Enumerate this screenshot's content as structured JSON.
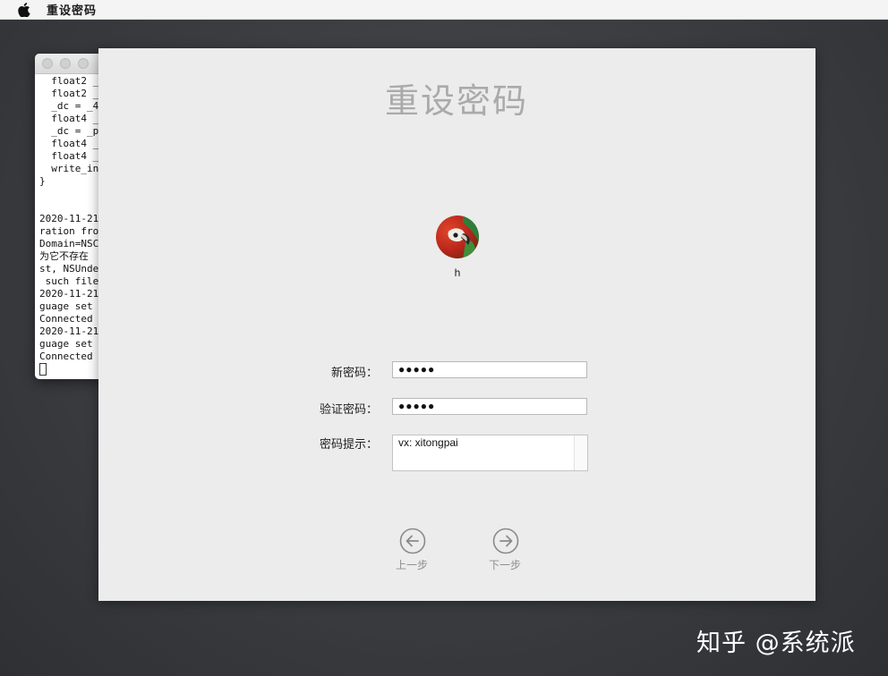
{
  "menubar": {
    "app_title": "重设密码"
  },
  "terminal": {
    "lines": [
      "  float2 _",
      "  float2 _",
      "  _dc = _4",
      "  float4 _",
      "  _dc = _p",
      "  float4 _",
      "  float4 _",
      "  write_in",
      "}",
      "",
      "",
      "2020-11-21",
      "ration fro",
      "Domain=NSC",
      "为它不存在",
      "st, NSUnde",
      " such file",
      "2020-11-21",
      "guage set",
      "Connected",
      "2020-11-21",
      "guage set",
      "Connected"
    ]
  },
  "panel": {
    "title": "重设密码",
    "user": {
      "name": "h"
    },
    "new_password": {
      "label": "新密码：",
      "value": "●●●●●"
    },
    "verify_password": {
      "label": "验证密码：",
      "value": "●●●●●"
    },
    "password_hint": {
      "label": "密码提示：",
      "value": "vx: xitongpai"
    },
    "back_button": {
      "label": "上一步",
      "icon": "arrow-left-circle-icon"
    },
    "next_button": {
      "label": "下一步",
      "icon": "arrow-right-circle-icon"
    }
  },
  "watermark": {
    "text": "知乎 @系统派"
  }
}
